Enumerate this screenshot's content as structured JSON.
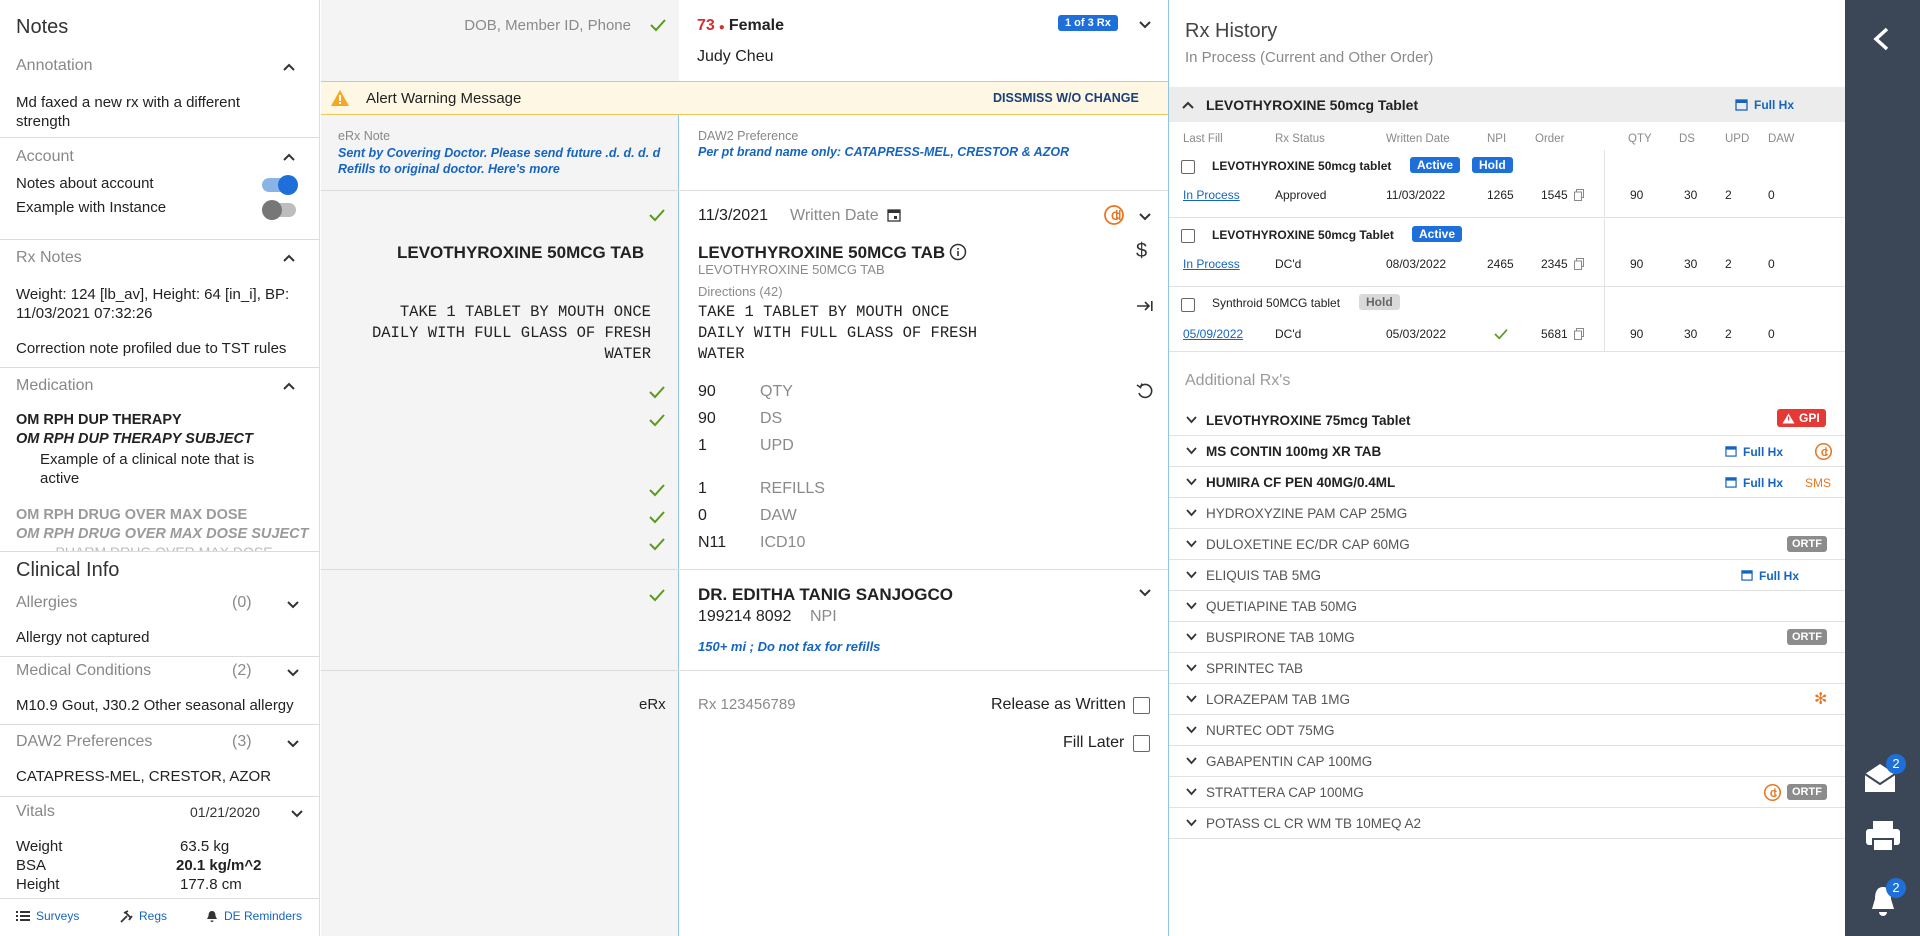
{
  "notes": {
    "title": "Notes",
    "annotation": {
      "header": "Annotation",
      "text": "Md faxed a new rx with a different strength"
    },
    "account": {
      "header": "Account",
      "toggle1": "Notes about account",
      "toggle2": "Example with Instance"
    },
    "rx_notes": {
      "header": "Rx Notes",
      "line1": "Weight: 124 [lb_av], Height: 64 [in_i], BP: 11/03/2021 07:32:26",
      "line2": "Correction note profiled due to TST rules"
    },
    "medication": {
      "header": "Medication",
      "item1_title": "OM RPH DUP THERAPY",
      "item1_subject": "OM RPH DUP THERAPY SUBJECT",
      "item1_text": "Example of a clinical note that is active",
      "item2_title": "OM RPH DRUG OVER MAX DOSE",
      "item2_subject": "OM RPH DRUG OVER MAX DOSE SUJECT",
      "item2_text": "... PHARM DRUG OVER MAX DOSE"
    }
  },
  "clinical": {
    "title": "Clinical Info",
    "allergies": {
      "label": "Allergies",
      "count": "(0)",
      "text": "Allergy not captured"
    },
    "conditions": {
      "label": "Medical Conditions",
      "count": "(2)",
      "text": "M10.9 Gout, J30.2 Other seasonal allergy"
    },
    "daw2": {
      "label": "DAW2 Preferences",
      "count": "(3)",
      "text": "CATAPRESS-MEL, CRESTOR, AZOR"
    },
    "vitals": {
      "label": "Vitals",
      "date": "01/21/2020",
      "weight_label": "Weight",
      "weight": "63.5 kg",
      "bsa_label": "BSA",
      "bsa": "20.1 kg/m^2",
      "height_label": "Height",
      "height": "177.8 cm"
    }
  },
  "footer": {
    "surveys": "Surveys",
    "regs": "Regs",
    "reminders": "DE Reminders"
  },
  "patient": {
    "search_placeholder": "DOB, Member ID, Phone",
    "age": "73",
    "sex": "Female",
    "name": "Judy Cheu",
    "rx_badge": "1 of 3 Rx"
  },
  "alert": {
    "text": "Alert Warning Message",
    "dismiss": "DISSMISS W/O CHANGE"
  },
  "erx_note": {
    "label": "eRx Note",
    "text": "Sent by Covering Doctor. Please send future .d. d. d. d Refills to original doctor.",
    "more": "Here's more"
  },
  "daw2_pref": {
    "label": "DAW2 Preference",
    "text": "Per pt brand name only: CATAPRESS-MEL, CRESTOR & AZOR"
  },
  "rx": {
    "date": "11/3/2021",
    "date_label": "Written Date",
    "orig_drug": "LEVOTHYROXINE 50MCG TAB",
    "orig_directions": "TAKE 1 TABLET BY MOUTH ONCE DAILY WITH FULL GLASS OF FRESH WATER",
    "drug": "LEVOTHYROXINE 50MCG TAB",
    "drug_sub": "LEVOTHYROXINE 50MCG TAB",
    "directions_label": "Directions (42)",
    "directions": "TAKE 1 TABLET BY MOUTH ONCE DAILY WITH FULL GLASS OF FRESH WATER",
    "qty": "90",
    "qty_label": "QTY",
    "ds": "90",
    "ds_label": "DS",
    "upd": "1",
    "upd_label": "UPD",
    "refills": "1",
    "refills_label": "REFILLS",
    "daw": "0",
    "daw_label": "DAW",
    "icd": "N11",
    "icd_label": "ICD10"
  },
  "prescriber": {
    "name": "DR. EDITHA TANIG SANJOGCO",
    "npi": "199214 8092",
    "npi_label": "NPI",
    "note": "150+ mi ; Do not fax for refills"
  },
  "bottom": {
    "erx": "eRx",
    "rx_number": "Rx 123456789",
    "release": "Release as Written",
    "fill_later": "Fill Later"
  },
  "history": {
    "title": "Rx History",
    "subtitle": "In Process (Current and Other Order)",
    "group": "LEVOTHYROXINE 50mcg Tablet",
    "full_hx": "Full Hx",
    "columns": [
      "Last Fill",
      "Rx Status",
      "Written Date",
      "NPI",
      "Order",
      "QTY",
      "DS",
      "UPD",
      "DAW"
    ],
    "rows": [
      {
        "name": "LEVOTHYROXINE 50mcg tablet",
        "badges": [
          "Active",
          "Hold"
        ],
        "last_fill": "In Process",
        "status": "Approved",
        "written": "11/03/2022",
        "npi": "1265",
        "order": "1545",
        "qty": "90",
        "ds": "30",
        "upd": "2",
        "daw": "0"
      },
      {
        "name": "LEVOTHYROXINE 50mcg Tablet",
        "badges": [
          "Active"
        ],
        "last_fill": "In Process",
        "status": "DC'd",
        "written": "08/03/2022",
        "npi": "2465",
        "order": "2345",
        "qty": "90",
        "ds": "30",
        "upd": "2",
        "daw": "0"
      },
      {
        "name": "Synthroid 50MCG tablet",
        "badges": [
          "Hold"
        ],
        "last_fill": "05/09/2022",
        "status": "DC'd",
        "written": "05/03/2022",
        "npi": "",
        "order": "5681",
        "qty": "90",
        "ds": "30",
        "upd": "2",
        "daw": "0"
      }
    ],
    "additional_title": "Additional Rx's",
    "additional": [
      {
        "name": "LEVOTHYROXINE 75mcg Tablet",
        "bold": true,
        "tag": "GPI"
      },
      {
        "name": "MS CONTIN 100mg XR TAB",
        "bold": true,
        "fullhx": "Full Hx",
        "icon": "CII"
      },
      {
        "name": "HUMIRA CF PEN 40MG/0.4ML",
        "bold": true,
        "fullhx": "Full Hx",
        "sms": "SMS"
      },
      {
        "name": "HYDROXYZINE PAM CAP 25MG"
      },
      {
        "name": "DULOXETINE EC/DR CAP 60MG",
        "ortf": "ORTF"
      },
      {
        "name": "ELIQUIS TAB 5MG",
        "fullhx": "Full Hx"
      },
      {
        "name": "QUETIAPINE TAB 50MG"
      },
      {
        "name": "BUSPIRONE TAB 10MG",
        "ortf": "ORTF"
      },
      {
        "name": "SPRINTEC TAB"
      },
      {
        "name": "LORAZEPAM TAB 1MG",
        "snow": true
      },
      {
        "name": "NURTEC ODT 75MG"
      },
      {
        "name": "GABAPENTIN CAP 100MG"
      },
      {
        "name": "STRATTERA CAP 100MG",
        "ortf": "ORTF",
        "icon": "CII"
      },
      {
        "name": "POTASS CL CR WM TB 10MEQ A2"
      }
    ]
  },
  "sidebar": {
    "mail_count": "2",
    "bell_count": "2"
  },
  "colors": {
    "accent": "#1565c0",
    "alert_bg": "#fdf7e3",
    "alert_icon": "#f5a623",
    "age": "#d32f2f",
    "gpi": "#e53935",
    "sidebar": "#3b4757"
  }
}
